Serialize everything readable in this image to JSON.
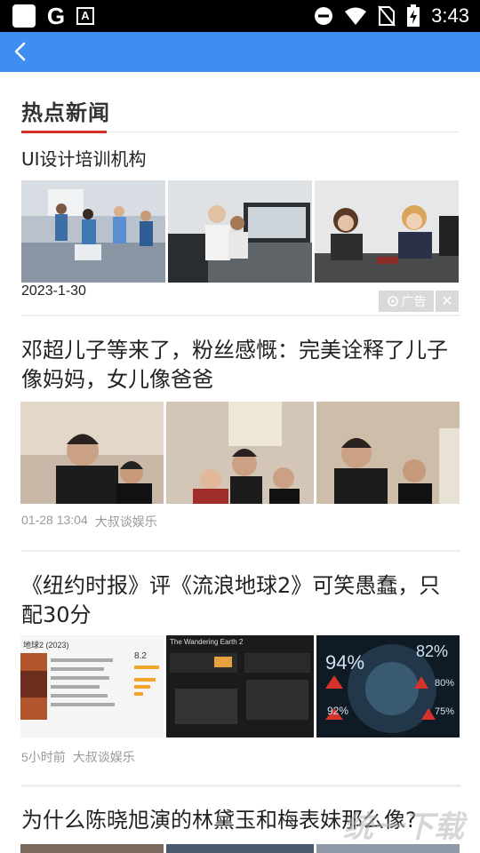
{
  "status_bar": {
    "time": "3:43",
    "icons": [
      "app-icon",
      "google-icon",
      "font-icon",
      "do-not-disturb-icon",
      "wifi-icon",
      "no-sim-icon",
      "battery-icon"
    ]
  },
  "nav": {
    "back_icon": "back-arrow-icon"
  },
  "section": {
    "title": "热点新闻"
  },
  "ad": {
    "title": "UI设计培训机构",
    "date": "2023-1-30",
    "tag_label": "广告",
    "close_icon": "close-icon"
  },
  "news": [
    {
      "title": "邓超儿子等来了，粉丝感慨：完美诠释了儿子像妈妈，女儿像爸爸",
      "time": "01-28 13:04",
      "source": "大叔谈娱乐"
    },
    {
      "title": "《纽约时报》评《流浪地球2》可笑愚蠢，只配30分",
      "time": "5小时前",
      "source": "大叔谈娱乐",
      "thumb_texts": {
        "movie_title": "地球2 (2023)",
        "score": "8.2",
        "poster_title": "The Wandering Earth 2",
        "pct_94": "94%",
        "pct_82": "82%",
        "pct_92": "92%",
        "pct_80": "80%",
        "pct_75": "75%"
      }
    },
    {
      "title": "为什么陈晓旭演的林黛玉和梅表妹那么像?"
    }
  ],
  "watermark": "统一下载",
  "colors": {
    "title_bar": "#3d8ef0",
    "accent_red": "#d9302a",
    "status_bar": "#000000"
  }
}
